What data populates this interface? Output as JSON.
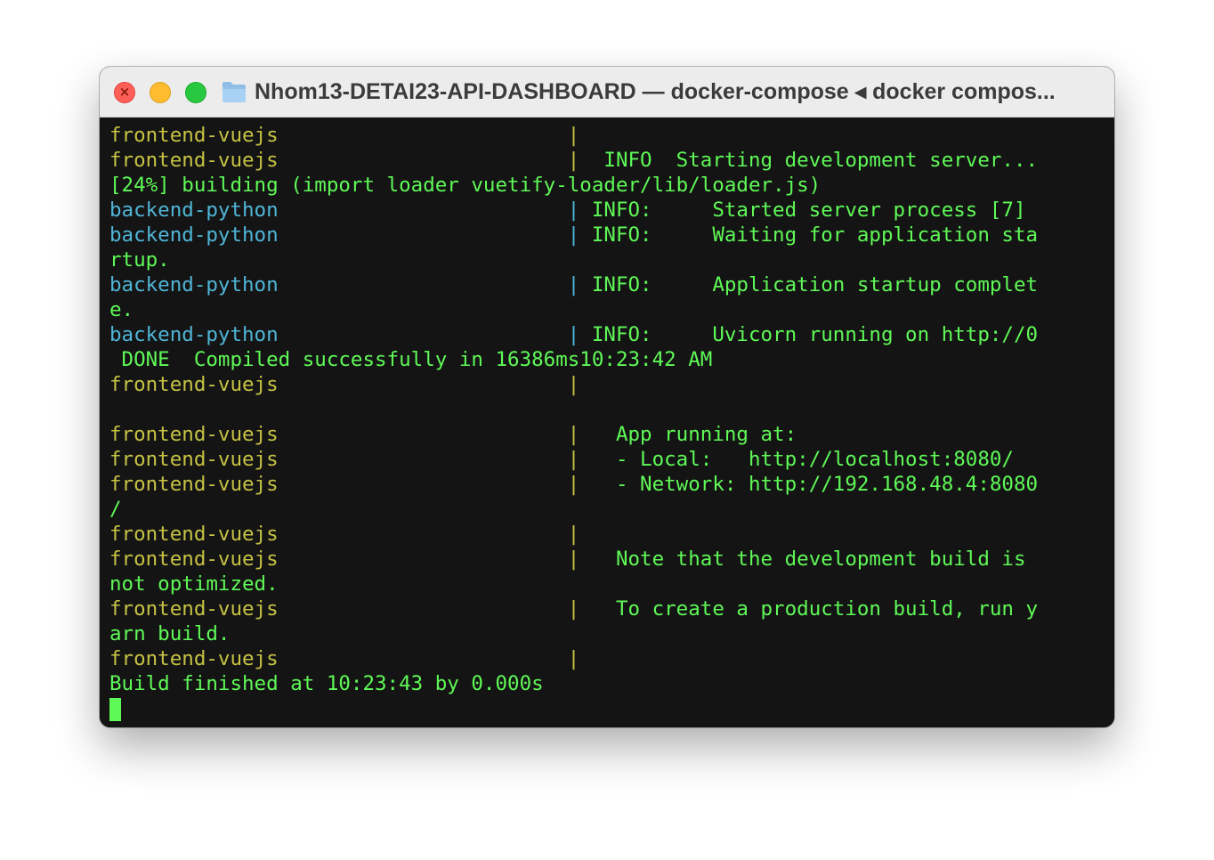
{
  "window": {
    "title": "Nhom13-DETAI23-API-DASHBOARD — docker-compose ◂ docker compos...",
    "close_glyph": "×",
    "folder_icon": "folder-icon",
    "colors": {
      "close": "#ff5f57",
      "minimize": "#febc2e",
      "maximize": "#28c840",
      "frontend_prefix": "#c6c244",
      "backend_prefix": "#4fb5d7",
      "output": "#5ff957",
      "background": "#141414"
    }
  },
  "terminal": {
    "lines": [
      {
        "prefix": "frontend-vuejs",
        "pad": "                        ",
        "sep": "|",
        "text": "",
        "kind": "frontend"
      },
      {
        "prefix": "frontend-vuejs",
        "pad": "                        ",
        "sep": "|",
        "text": "  INFO  Starting development server...",
        "kind": "frontend"
      },
      {
        "prefix": "",
        "pad": "",
        "sep": "",
        "text": "[24%] building (import loader vuetify-loader/lib/loader.js)",
        "kind": "plain"
      },
      {
        "prefix": "backend-python",
        "pad": "                        ",
        "sep": "|",
        "text": " INFO:     Started server process [7]",
        "kind": "backend"
      },
      {
        "prefix": "backend-python",
        "pad": "                        ",
        "sep": "|",
        "text": " INFO:     Waiting for application sta",
        "kind": "backend"
      },
      {
        "prefix": "",
        "pad": "",
        "sep": "",
        "text": "rtup.",
        "kind": "plain"
      },
      {
        "prefix": "backend-python",
        "pad": "                        ",
        "sep": "|",
        "text": " INFO:     Application startup complet",
        "kind": "backend"
      },
      {
        "prefix": "",
        "pad": "",
        "sep": "",
        "text": "e.",
        "kind": "plain"
      },
      {
        "prefix": "backend-python",
        "pad": "                        ",
        "sep": "|",
        "text": " INFO:     Uvicorn running on http://0",
        "kind": "backend"
      },
      {
        "prefix": "",
        "pad": "",
        "sep": "",
        "text": " DONE  Compiled successfully in 16386ms10:23:42 AM",
        "kind": "plain"
      },
      {
        "prefix": "frontend-vuejs",
        "pad": "                        ",
        "sep": "|",
        "text": "",
        "kind": "frontend"
      },
      {
        "prefix": "",
        "pad": "",
        "sep": "",
        "text": "",
        "kind": "plain"
      },
      {
        "prefix": "frontend-vuejs",
        "pad": "                        ",
        "sep": "|",
        "text": "   App running at:",
        "kind": "frontend"
      },
      {
        "prefix": "frontend-vuejs",
        "pad": "                        ",
        "sep": "|",
        "text": "   - Local:   http://localhost:8080/",
        "kind": "frontend"
      },
      {
        "prefix": "frontend-vuejs",
        "pad": "                        ",
        "sep": "|",
        "text": "   - Network: http://192.168.48.4:8080",
        "kind": "frontend"
      },
      {
        "prefix": "",
        "pad": "",
        "sep": "",
        "text": "/",
        "kind": "plain"
      },
      {
        "prefix": "frontend-vuejs",
        "pad": "                        ",
        "sep": "|",
        "text": "",
        "kind": "frontend"
      },
      {
        "prefix": "frontend-vuejs",
        "pad": "                        ",
        "sep": "|",
        "text": "   Note that the development build is",
        "kind": "frontend"
      },
      {
        "prefix": "",
        "pad": "",
        "sep": "",
        "text": "not optimized.",
        "kind": "plain"
      },
      {
        "prefix": "frontend-vuejs",
        "pad": "                        ",
        "sep": "|",
        "text": "   To create a production build, run y",
        "kind": "frontend"
      },
      {
        "prefix": "",
        "pad": "",
        "sep": "",
        "text": "arn build.",
        "kind": "plain"
      },
      {
        "prefix": "frontend-vuejs",
        "pad": "                        ",
        "sep": "|",
        "text": "",
        "kind": "frontend"
      },
      {
        "prefix": "",
        "pad": "",
        "sep": "",
        "text": "Build finished at 10:23:43 by 0.000s",
        "kind": "plain"
      }
    ]
  }
}
